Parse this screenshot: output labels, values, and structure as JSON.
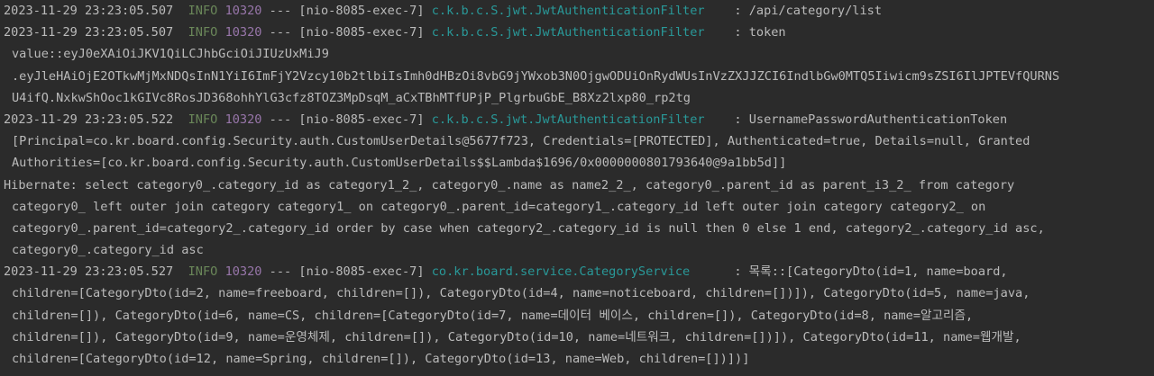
{
  "entries": [
    {
      "timestamp": "2023-11-29 23:23:05.507",
      "level": "INFO",
      "pid": "10320",
      "sep": "---",
      "thread": "[nio-8085-exec-7]",
      "logger": "c.k.b.c.S.jwt.JwtAuthenticationFilter",
      "logger_pad": "    ",
      "message": ": /api/category/list"
    },
    {
      "timestamp": "2023-11-29 23:23:05.507",
      "level": "INFO",
      "pid": "10320",
      "sep": "---",
      "thread": "[nio-8085-exec-7]",
      "logger": "c.k.b.c.S.jwt.JwtAuthenticationFilter",
      "logger_pad": "    ",
      "message": ": token",
      "continuation": [
        "value::eyJ0eXAiOiJKV1QiLCJhbGciOiJIUzUxMiJ9",
        ".eyJleHAiOjE2OTkwMjMxNDQsInN1YiI6ImFjY2Vzcy10b2tlbiIsImh0dHBzOi8vbG9jYWxob3N0OjgwODUiOnRydWUsInVzZXJJZCI6IndlbGw0MTQ5Iiwicm9sZSI6IlJPTEVfQURNS",
        "U4ifQ.NxkwShOoc1kGIVc8RosJD368ohhYlG3cfz8TOZ3MpDsqM_aCxTBhMTfUPjP_PlgrbuGbE_B8Xz2lxp80_rp2tg"
      ]
    },
    {
      "timestamp": "2023-11-29 23:23:05.522",
      "level": "INFO",
      "pid": "10320",
      "sep": "---",
      "thread": "[nio-8085-exec-7]",
      "logger": "c.k.b.c.S.jwt.JwtAuthenticationFilter",
      "logger_pad": "    ",
      "message": ": UsernamePasswordAuthenticationToken",
      "continuation": [
        "[Principal=co.kr.board.config.Security.auth.CustomUserDetails@5677f723, Credentials=[PROTECTED], Authenticated=true, Details=null, Granted",
        "Authorities=[co.kr.board.config.Security.auth.CustomUserDetails$$Lambda$1696/0x0000000801793640@9a1bb5d]]"
      ]
    },
    {
      "hibernate": "Hibernate: select category0_.category_id as category1_2_, category0_.name as name2_2_, category0_.parent_id as parent_i3_2_ from category",
      "continuation": [
        "category0_ left outer join category category1_ on category0_.parent_id=category1_.category_id left outer join category category2_ on",
        "category0_.parent_id=category2_.category_id order by case when category2_.category_id is null then 0 else 1 end, category2_.category_id asc,",
        "category0_.category_id asc"
      ]
    },
    {
      "timestamp": "2023-11-29 23:23:05.527",
      "level": "INFO",
      "pid": "10320",
      "sep": "---",
      "thread": "[nio-8085-exec-7]",
      "logger": "co.kr.board.service.CategoryService",
      "logger_pad": "      ",
      "message": ": 목록::[CategoryDto(id=1, name=board,",
      "continuation": [
        "children=[CategoryDto(id=2, name=freeboard, children=[]), CategoryDto(id=4, name=noticeboard, children=[])]), CategoryDto(id=5, name=java,",
        "children=[]), CategoryDto(id=6, name=CS, children=[CategoryDto(id=7, name=데이터 베이스, children=[]), CategoryDto(id=8, name=알고리즘,",
        "children=[]), CategoryDto(id=9, name=운영체제, children=[]), CategoryDto(id=10, name=네트워크, children=[])]), CategoryDto(id=11, name=웹개발,",
        "children=[CategoryDto(id=12, name=Spring, children=[]), CategoryDto(id=13, name=Web, children=[])])]"
      ]
    }
  ],
  "colors": {
    "background": "#2b2b2b",
    "text": "#bbbbbb",
    "level_info": "#6a8759",
    "pid": "#9876aa",
    "logger": "#299999"
  }
}
